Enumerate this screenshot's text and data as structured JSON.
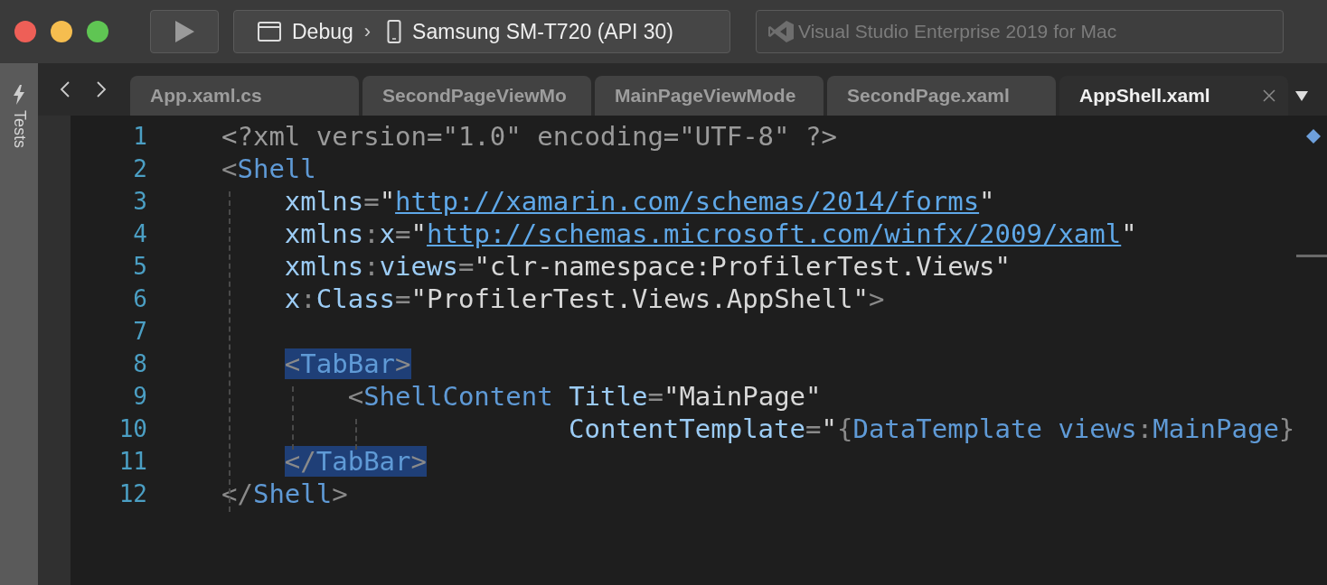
{
  "toolbar": {
    "configuration": "Debug",
    "separator": "›",
    "device": "Samsung SM-T720 (API 30)",
    "status": "Visual Studio Enterprise 2019 for Mac"
  },
  "side_pad": {
    "label": "Tests"
  },
  "tabs": [
    {
      "label": "App.xaml.cs",
      "selected": false
    },
    {
      "label": "SecondPageViewMo",
      "selected": false
    },
    {
      "label": "MainPageViewMode",
      "selected": false
    },
    {
      "label": "SecondPage.xaml",
      "selected": false
    },
    {
      "label": "AppShell.xaml",
      "selected": true
    }
  ],
  "editor": {
    "lines": [
      {
        "number": "1",
        "highlighted": false,
        "tokens": [
          {
            "kind": "decl",
            "text": "<?xml version=\"1.0\" encoding=\"UTF-8\" ?>"
          }
        ]
      },
      {
        "number": "2",
        "highlighted": false,
        "tokens": [
          {
            "kind": "punct",
            "text": "<"
          },
          {
            "kind": "tag",
            "text": "Shell"
          }
        ]
      },
      {
        "number": "3",
        "highlighted": false,
        "tokens": [
          {
            "kind": "attr",
            "text": "    xmlns"
          },
          {
            "kind": "punct",
            "text": "="
          },
          {
            "kind": "string",
            "text": "\""
          },
          {
            "kind": "link",
            "text": "http://xamarin.com/schemas/2014/forms"
          },
          {
            "kind": "string",
            "text": "\""
          }
        ]
      },
      {
        "number": "4",
        "highlighted": false,
        "tokens": [
          {
            "kind": "attr",
            "text": "    xmlns"
          },
          {
            "kind": "punct",
            "text": ":"
          },
          {
            "kind": "attr",
            "text": "x"
          },
          {
            "kind": "punct",
            "text": "="
          },
          {
            "kind": "string",
            "text": "\""
          },
          {
            "kind": "link",
            "text": "http://schemas.microsoft.com/winfx/2009/xaml"
          },
          {
            "kind": "string",
            "text": "\""
          }
        ]
      },
      {
        "number": "5",
        "highlighted": false,
        "tokens": [
          {
            "kind": "attr",
            "text": "    xmlns"
          },
          {
            "kind": "punct",
            "text": ":"
          },
          {
            "kind": "attr",
            "text": "views"
          },
          {
            "kind": "punct",
            "text": "="
          },
          {
            "kind": "string",
            "text": "\"clr-namespace:ProfilerTest.Views\""
          }
        ]
      },
      {
        "number": "6",
        "highlighted": false,
        "tokens": [
          {
            "kind": "attr",
            "text": "    x"
          },
          {
            "kind": "punct",
            "text": ":"
          },
          {
            "kind": "attr",
            "text": "Class"
          },
          {
            "kind": "punct",
            "text": "="
          },
          {
            "kind": "string",
            "text": "\"ProfilerTest.Views.AppShell\""
          },
          {
            "kind": "punct",
            "text": ">"
          }
        ]
      },
      {
        "number": "7"
      },
      {
        "number": "8",
        "highlighted": true,
        "tokens": [
          {
            "kind": "punct",
            "text": "    <"
          },
          {
            "kind": "tag",
            "text": "TabBar"
          },
          {
            "kind": "punct",
            "text": ">"
          }
        ]
      },
      {
        "number": "9",
        "highlighted": false,
        "tokens": [
          {
            "kind": "punct",
            "text": "        <"
          },
          {
            "kind": "tag",
            "text": "ShellContent"
          },
          {
            "kind": "attr",
            "text": " Title"
          },
          {
            "kind": "punct",
            "text": "="
          },
          {
            "kind": "string",
            "text": "\"MainPage\""
          }
        ]
      },
      {
        "number": "10",
        "highlighted": false,
        "tokens": [
          {
            "kind": "attr",
            "text": "                      ContentTemplate"
          },
          {
            "kind": "punct",
            "text": "="
          },
          {
            "kind": "string",
            "text": "\""
          },
          {
            "kind": "punct",
            "text": "{"
          },
          {
            "kind": "tag",
            "text": "DataTemplate views"
          },
          {
            "kind": "punct",
            "text": ":"
          },
          {
            "kind": "tag",
            "text": "MainPage"
          },
          {
            "kind": "punct",
            "text": "}"
          }
        ]
      },
      {
        "number": "11",
        "highlighted": true,
        "tokens": [
          {
            "kind": "punct",
            "text": "    </"
          },
          {
            "kind": "tag",
            "text": "TabBar"
          },
          {
            "kind": "punct",
            "text": ">"
          }
        ]
      },
      {
        "number": "12",
        "highlighted": false,
        "tokens": [
          {
            "kind": "punct",
            "text": "</"
          },
          {
            "kind": "tag",
            "text": "Shell"
          },
          {
            "kind": "punct",
            "text": ">"
          }
        ]
      }
    ]
  }
}
